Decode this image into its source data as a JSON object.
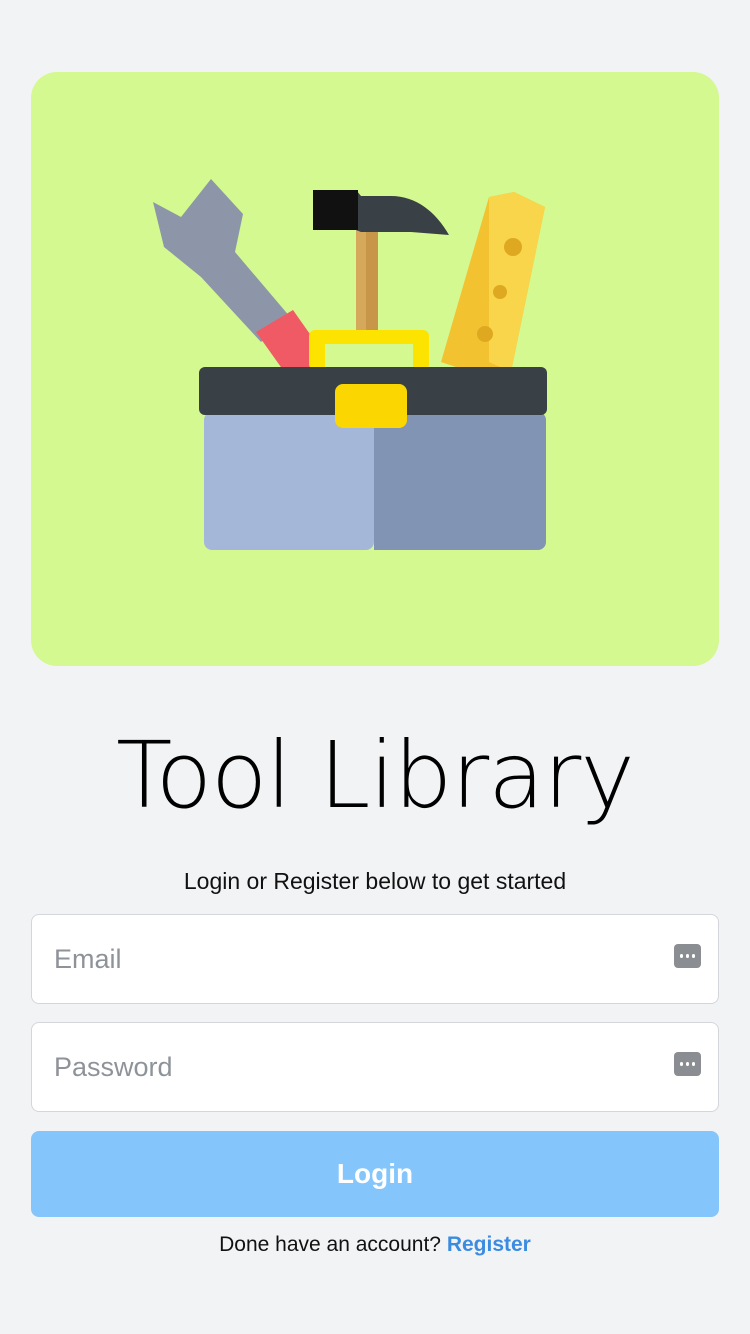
{
  "hero": {
    "illustration": "toolbox-icon",
    "background_color": "#d3f990"
  },
  "title": "Tool Library",
  "subtitle": "Login or Register below to get started",
  "form": {
    "email_placeholder": "Email",
    "password_placeholder": "Password",
    "autofill_icon": "password-key-icon",
    "login_label": "Login",
    "login_color": "#84c6fc"
  },
  "footer": {
    "prompt": "Done have an account?",
    "register_label": "Register",
    "link_color": "#3b8ce0"
  }
}
